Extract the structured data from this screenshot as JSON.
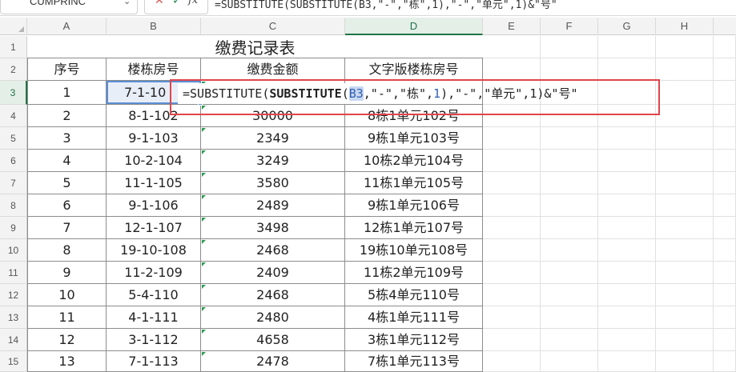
{
  "formula_bar": {
    "name_box": "CUMPRINC",
    "cancel_icon": "✕",
    "confirm_icon": "✓",
    "fx_label": "fx",
    "formula": "=SUBSTITUTE(SUBSTITUTE(B3,\"-\",\"栋\",1),\"-\",\"单元\",1)&\"号\""
  },
  "columns": [
    "A",
    "B",
    "C",
    "D",
    "E",
    "F",
    "G",
    "H"
  ],
  "rows": [
    "1",
    "2",
    "3",
    "4",
    "5",
    "6",
    "7",
    "8",
    "9",
    "10",
    "11",
    "12",
    "13",
    "14",
    "15"
  ],
  "sheet": {
    "title": "缴费记录表",
    "headers": [
      "序号",
      "楼栋房号",
      "缴费金额",
      "文字版楼栋房号"
    ],
    "data": [
      [
        "1",
        "7-1-10",
        "",
        ""
      ],
      [
        "2",
        "8-1-102",
        "30000",
        "8栋1单元102号"
      ],
      [
        "3",
        "9-1-103",
        "2349",
        "9栋1单元103号"
      ],
      [
        "4",
        "10-2-104",
        "3249",
        "10栋2单元104号"
      ],
      [
        "5",
        "11-1-105",
        "3580",
        "11栋1单元105号"
      ],
      [
        "6",
        "9-1-106",
        "2489",
        "9栋1单元106号"
      ],
      [
        "7",
        "12-1-107",
        "3498",
        "12栋1单元107号"
      ],
      [
        "8",
        "19-10-108",
        "2468",
        "19栋10单元108号"
      ],
      [
        "9",
        "11-2-109",
        "2409",
        "11栋2单元109号"
      ],
      [
        "10",
        "5-4-110",
        "2468",
        "5栋4单元110号"
      ],
      [
        "11",
        "4-1-111",
        "2480",
        "4栋1单元111号"
      ],
      [
        "12",
        "3-1-112",
        "4658",
        "3栋1单元112号"
      ],
      [
        "13",
        "7-1-113",
        "2478",
        "7栋1单元113号"
      ]
    ]
  },
  "editor": {
    "p1": "=SUBSTITUTE(",
    "fn": "SUBSTITUTE",
    "p2": "(",
    "ref": "B3",
    "p3": ",\"-\",\"栋\",",
    "n1": "1",
    "p4": "),\"-\",\"单元\",1)&\"号\""
  },
  "colors": {
    "accent_green": "#217346",
    "editor_border": "#e0454a",
    "ref_blue": "#2f5fb3"
  }
}
